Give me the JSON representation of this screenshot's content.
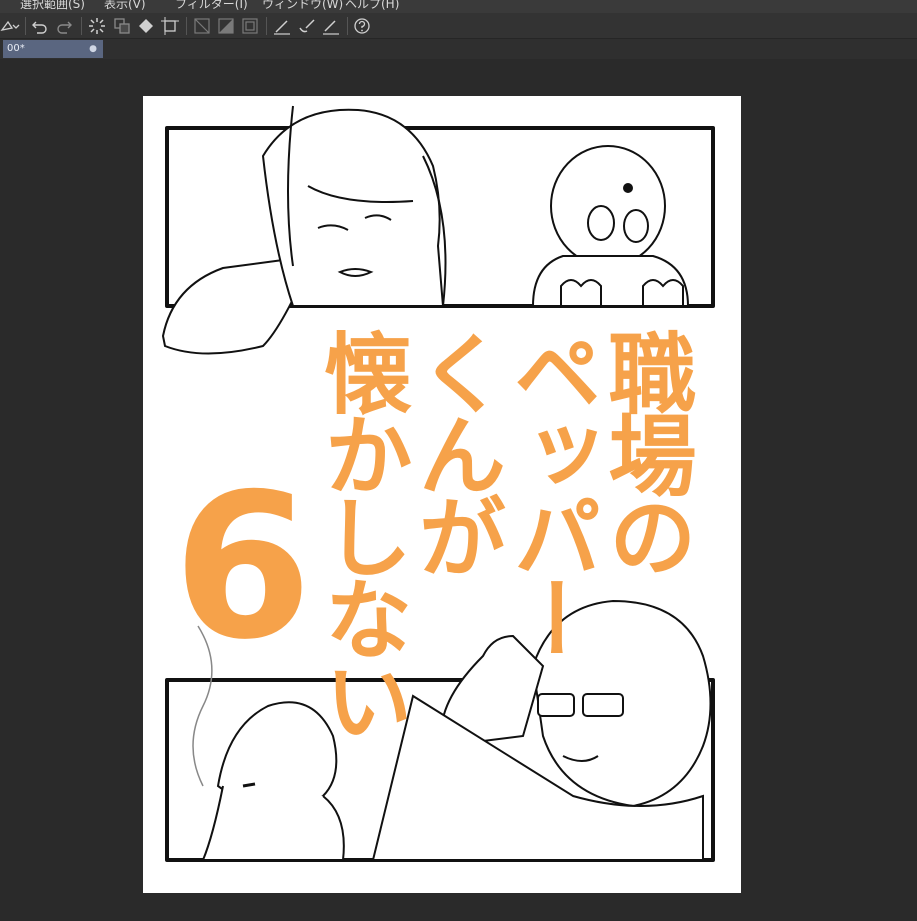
{
  "menu": {
    "items": [
      "選択範囲(S)",
      "表示(V)",
      "フィルター(I)",
      "ウィンドウ(W)",
      "ヘルプ(H)"
    ]
  },
  "toolbar": {
    "icons": [
      "select-launcher-icon",
      "undo-icon",
      "redo-icon",
      "loading-icon",
      "copy-icon",
      "fill-icon",
      "transform-icon",
      "ruler-icon",
      "gradient-icon",
      "frame-icon",
      "pen-icon",
      "brush-icon",
      "eraser-icon",
      "help-icon"
    ]
  },
  "document": {
    "tab_label": "00*",
    "tab_close": "●"
  },
  "cover": {
    "title_columns": [
      "職場の",
      "ペッパー",
      "くんが",
      "懐かしない"
    ],
    "volume": "6",
    "accent_color": "#f6a24a"
  }
}
